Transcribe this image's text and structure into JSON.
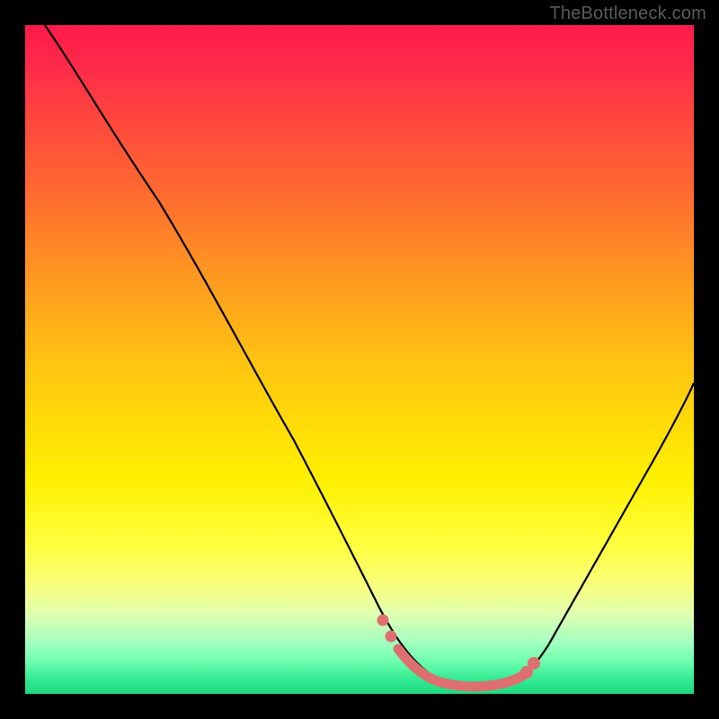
{
  "watermark": {
    "text": "TheBottleneck.com"
  },
  "gradient": {
    "top_color": "#ff1a4a",
    "mid_color": "#fff000",
    "bottom_color": "#20d880"
  },
  "chart_data": {
    "type": "line",
    "title": "",
    "xlabel": "",
    "ylabel": "",
    "xlim": [
      0,
      100
    ],
    "ylim": [
      0,
      100
    ],
    "series": [
      {
        "name": "bottleneck-curve",
        "color": "#000000",
        "x": [
          3,
          10,
          20,
          30,
          40,
          48,
          52,
          56,
          60,
          64,
          68,
          72,
          74,
          78,
          85,
          92,
          100
        ],
        "y": [
          100,
          90,
          74,
          57,
          38,
          20,
          12,
          6,
          3,
          1.5,
          1,
          1,
          1.2,
          2,
          10,
          25,
          48
        ]
      },
      {
        "name": "optimal-range-highlight",
        "color": "#e06c6c",
        "x": [
          52,
          56,
          60,
          64,
          68,
          72,
          74,
          76
        ],
        "y": [
          12,
          6,
          3,
          1.5,
          1,
          1,
          1.2,
          1.8
        ]
      }
    ],
    "highlight_markers": {
      "color": "#e06c6c",
      "points_x": [
        52,
        55,
        74,
        76
      ],
      "points_y": [
        12,
        8,
        1.2,
        1.8
      ]
    }
  }
}
